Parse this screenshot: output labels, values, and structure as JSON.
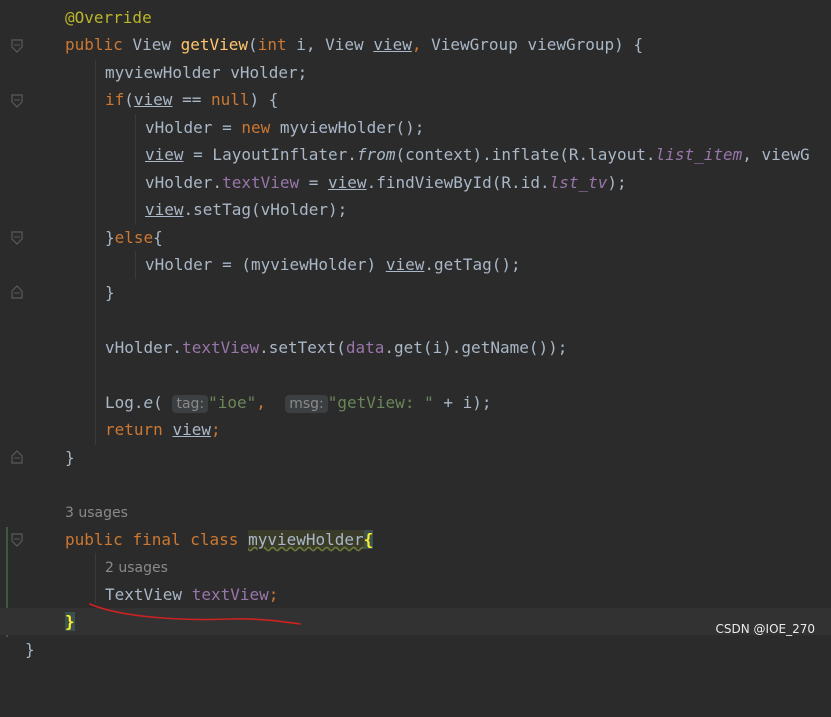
{
  "code": {
    "override": "@Override",
    "kw_public": "public",
    "type_view": "View",
    "method_getview": "getView",
    "paren_open": "(",
    "kw_int": "int",
    "param_i": "i,",
    "type_view2": "View",
    "param_view": "view",
    "comma": ",",
    "type_viewgroup": "ViewGroup",
    "param_viewgroup": "viewGroup",
    "sig_end": ") {",
    "decl_line": "myviewHolder vHolder;",
    "kw_if": "if",
    "if_open": "(",
    "if_view": "view",
    "if_eq": " == ",
    "kw_null": "null",
    "if_end": ") {",
    "l5_a": "vHolder = ",
    "kw_new": "new",
    "l5_b": " myviewHolder();",
    "l6_view": "view",
    "l6_a": " = LayoutInflater.",
    "l6_from": "from",
    "l6_b": "(context).inflate(R.layout.",
    "l6_res": "list_item",
    "l6_c": ", viewG",
    "l7_a": "vHolder.",
    "l7_field": "textView",
    "l7_b": " = ",
    "l7_view": "view",
    "l7_c": ".findViewById(R.id.",
    "l7_res": "lst_tv",
    "l7_d": ");",
    "l8_view": "view",
    "l8_a": ".setTag(vHolder);",
    "else_close": "}",
    "kw_else": "else",
    "else_open": "{",
    "l10_a": "vHolder = (myviewHolder) ",
    "l10_view": "view",
    "l10_b": ".getTag();",
    "close_brace": "}",
    "l12_a": "vHolder.",
    "l12_field": "textView",
    "l12_b": ".setText(",
    "l12_data": "data",
    "l12_c": ".get(i).getName());",
    "log_a": "Log.",
    "log_e": "e",
    "log_paren": "(",
    "hint_tag": "tag:",
    "str_ioe": "\"ioe\"",
    "log_comma": ",",
    "hint_msg": "msg:",
    "str_getview": "\"getView: \"",
    "log_end": " + i);",
    "kw_return": "return",
    "ret_view": "view",
    "ret_semi": ";",
    "method_close": "}",
    "usages_class": "3 usages",
    "kw_final": "final",
    "kw_class": "class",
    "class_name": "myviewHolder",
    "class_open": "{",
    "usages_field": "2 usages",
    "field_type": "TextView",
    "field_name": "textView",
    "class_close": "}",
    "partial_bottom": "}"
  },
  "watermark": "CSDN @IOE_270",
  "colors": {
    "background": "#2b2b2b",
    "keyword": "#cc7832",
    "annotation": "#bbb529",
    "method": "#ffc66d",
    "field": "#9876aa",
    "string": "#6a8759",
    "text": "#a9b7c6",
    "annotation_pen": "#cc2222"
  }
}
